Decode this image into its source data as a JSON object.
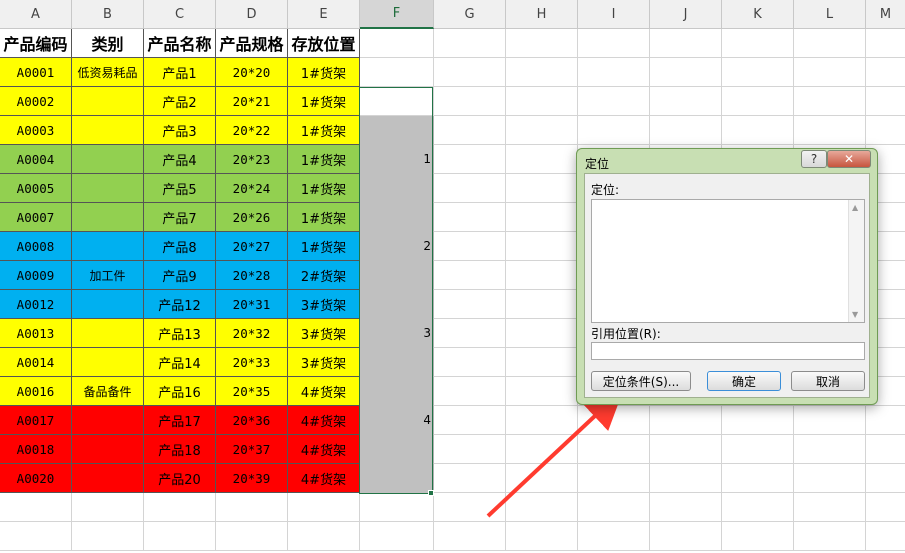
{
  "columns": [
    "A",
    "B",
    "C",
    "D",
    "E",
    "F",
    "G",
    "H",
    "I",
    "J",
    "K",
    "L",
    "M"
  ],
  "headers": [
    "产品编码",
    "类别",
    "产品名称",
    "产品规格",
    "存放位置"
  ],
  "rows": [
    {
      "code": "A0001",
      "cat": "低资易耗品",
      "name": "产品1",
      "spec": "20*20",
      "loc": "1#货架",
      "f": "",
      "color": "#ffff00"
    },
    {
      "code": "A0002",
      "cat": "",
      "name": "产品2",
      "spec": "20*21",
      "loc": "1#货架",
      "f": "",
      "color": "#ffff00"
    },
    {
      "code": "A0003",
      "cat": "",
      "name": "产品3",
      "spec": "20*22",
      "loc": "1#货架",
      "f": "",
      "color": "#ffff00"
    },
    {
      "code": "A0004",
      "cat": "",
      "name": "产品4",
      "spec": "20*23",
      "loc": "1#货架",
      "f": "1",
      "color": "#92d050"
    },
    {
      "code": "A0005",
      "cat": "",
      "name": "产品5",
      "spec": "20*24",
      "loc": "1#货架",
      "f": "",
      "color": "#92d050"
    },
    {
      "code": "A0007",
      "cat": "",
      "name": "产品7",
      "spec": "20*26",
      "loc": "1#货架",
      "f": "",
      "color": "#92d050"
    },
    {
      "code": "A0008",
      "cat": "",
      "name": "产品8",
      "spec": "20*27",
      "loc": "1#货架",
      "f": "2",
      "color": "#00b0f0"
    },
    {
      "code": "A0009",
      "cat": "加工件",
      "name": "产品9",
      "spec": "20*28",
      "loc": "2#货架",
      "f": "",
      "color": "#00b0f0"
    },
    {
      "code": "A0012",
      "cat": "",
      "name": "产品12",
      "spec": "20*31",
      "loc": "3#货架",
      "f": "",
      "color": "#00b0f0"
    },
    {
      "code": "A0013",
      "cat": "",
      "name": "产品13",
      "spec": "20*32",
      "loc": "3#货架",
      "f": "3",
      "color": "#ffff00"
    },
    {
      "code": "A0014",
      "cat": "",
      "name": "产品14",
      "spec": "20*33",
      "loc": "3#货架",
      "f": "",
      "color": "#ffff00"
    },
    {
      "code": "A0016",
      "cat": "备品备件",
      "name": "产品16",
      "spec": "20*35",
      "loc": "4#货架",
      "f": "",
      "color": "#ffff00"
    },
    {
      "code": "A0017",
      "cat": "",
      "name": "产品17",
      "spec": "20*36",
      "loc": "4#货架",
      "f": "4",
      "color": "#ff0000"
    },
    {
      "code": "A0018",
      "cat": "",
      "name": "产品18",
      "spec": "20*37",
      "loc": "4#货架",
      "f": "",
      "color": "#ff0000"
    },
    {
      "code": "A0020",
      "cat": "",
      "name": "产品20",
      "spec": "20*39",
      "loc": "4#货架",
      "f": "",
      "color": "#ff0000"
    }
  ],
  "selected_column": "F",
  "selection_fill": "#c0c0c0",
  "dialog": {
    "title": "定位",
    "help_label": "?",
    "close_label": "✕",
    "goto_label": "定位:",
    "reference_label": "引用位置(R):",
    "reference_value": "",
    "special_button": "定位条件(S)...",
    "ok_button": "确定",
    "cancel_button": "取消",
    "frame_color": "#c8dfb3"
  },
  "annotation_color": "#ff3b2f"
}
